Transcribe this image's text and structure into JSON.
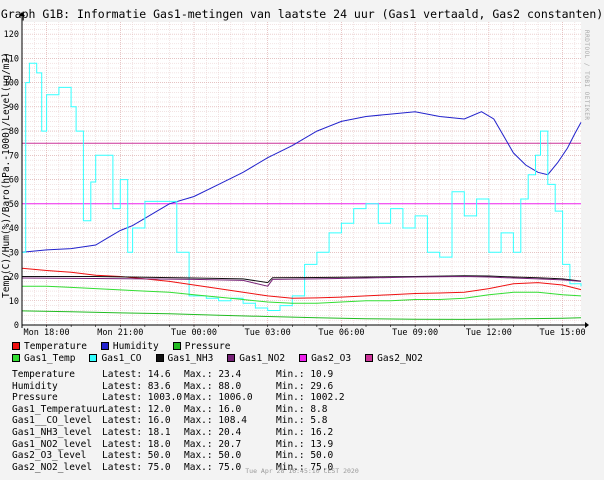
{
  "title": "Graph G1B: Informatie Gas1-metingen van laatste 24 uur (Gas1 vertaald, Gas2 constanten)",
  "side_text": "RRDTOOL / TOBI OETIKER",
  "footer": "Tue Apr 28 16:45:10 CEST 2020",
  "legend": [
    {
      "label": "Temperature",
      "color": "#ee1111"
    },
    {
      "label": "Humidity",
      "color": "#2222cc"
    },
    {
      "label": "Pressure",
      "color": "#22bb22"
    },
    {
      "label": "Gas1_Temp",
      "color": "#33dd33"
    },
    {
      "label": "Gas1_CO",
      "color": "#33ffff"
    },
    {
      "label": "Gas1_NH3",
      "color": "#111111"
    },
    {
      "label": "Gas1_NO2",
      "color": "#772277"
    },
    {
      "label": "Gas2_O3",
      "color": "#ee22ee"
    },
    {
      "label": "Gas2_NO2",
      "color": "#cc3399"
    }
  ],
  "stats": [
    {
      "name": "Temperature",
      "latest": "Latest: 14.6",
      "max": "Max.: 23.4",
      "min": "Min.: 10.9"
    },
    {
      "name": "Humidity",
      "latest": "Latest: 83.6",
      "max": "Max.: 88.0",
      "min": "Min.: 29.6"
    },
    {
      "name": "Pressure",
      "latest": "Latest: 1003.0",
      "max": "Max.: 1006.0",
      "min": "Min.: 1002.2"
    },
    {
      "name": "Gas1_Temperatuur",
      "latest": "Latest: 12.0",
      "max": "Max.: 16.0",
      "min": "Min.: 8.8"
    },
    {
      "name": "Gas1__CO_level",
      "latest": "Latest: 16.0",
      "max": "Max.: 108.4",
      "min": "Min.: 5.8"
    },
    {
      "name": "Gas1_NH3_level",
      "latest": "Latest: 18.1",
      "max": "Max.: 20.4",
      "min": "Min.: 16.2"
    },
    {
      "name": "Gas1_NO2_level",
      "latest": "Latest: 18.0",
      "max": "Max.: 20.7",
      "min": "Min.: 13.9"
    },
    {
      "name": "Gas2_O3_level",
      "latest": "Latest: 50.0",
      "max": "Max.: 50.0",
      "min": "Min.: 50.0"
    },
    {
      "name": "Gas2_NO2_level",
      "latest": "Latest: 75.0",
      "max": "Max.: 75.0",
      "min": "Min.: 75.0"
    }
  ],
  "chart_data": {
    "type": "line",
    "title": "Graph G1B: Informatie Gas1-metingen van laatste 24 uur (Gas1 vertaald, Gas2 constanten)",
    "ylabel": "Temp(C)/Hum(%)/Baro(hPa.-1000)/Level(ug/m3)",
    "xlabel": "",
    "ylim": [
      0,
      125
    ],
    "xlim": [
      0,
      22.75
    ],
    "yticks": [
      0,
      10,
      20,
      30,
      40,
      50,
      60,
      70,
      80,
      90,
      100,
      110,
      120
    ],
    "x_ticks": [
      {
        "label": "Mon 18:00",
        "x": 1
      },
      {
        "label": "Mon 21:00",
        "x": 4
      },
      {
        "label": "Tue 00:00",
        "x": 7
      },
      {
        "label": "Tue 03:00",
        "x": 10
      },
      {
        "label": "Tue 06:00",
        "x": 13
      },
      {
        "label": "Tue 09:00",
        "x": 16
      },
      {
        "label": "Tue 12:00",
        "x": 19
      },
      {
        "label": "Tue 15:00",
        "x": 22
      }
    ],
    "grid": true,
    "legend_position": "bottom",
    "series": [
      {
        "name": "Gas2_O3",
        "color": "#ee22ee",
        "points": [
          [
            0,
            50
          ],
          [
            22.75,
            50
          ]
        ]
      },
      {
        "name": "Gas2_NO2",
        "color": "#cc3399",
        "points": [
          [
            0,
            75
          ],
          [
            22.75,
            75
          ]
        ]
      },
      {
        "name": "Humidity",
        "color": "#2222cc",
        "points": [
          [
            0,
            30
          ],
          [
            1,
            31
          ],
          [
            2,
            31.5
          ],
          [
            3,
            33
          ],
          [
            3.5,
            36
          ],
          [
            4,
            39
          ],
          [
            4.5,
            41
          ],
          [
            5,
            44
          ],
          [
            5.5,
            47
          ],
          [
            6,
            50
          ],
          [
            7,
            53
          ],
          [
            8,
            58
          ],
          [
            9,
            63
          ],
          [
            10,
            69
          ],
          [
            11,
            74
          ],
          [
            12,
            80
          ],
          [
            13,
            84
          ],
          [
            14,
            86
          ],
          [
            15,
            87
          ],
          [
            16,
            88
          ],
          [
            17,
            86
          ],
          [
            18,
            85
          ],
          [
            18.7,
            88
          ],
          [
            19.2,
            85
          ],
          [
            19.6,
            78
          ],
          [
            20,
            71
          ],
          [
            20.5,
            66
          ],
          [
            21,
            63
          ],
          [
            21.4,
            62
          ],
          [
            21.8,
            67
          ],
          [
            22.2,
            73
          ],
          [
            22.5,
            79
          ],
          [
            22.75,
            83.6
          ]
        ]
      },
      {
        "name": "Gas1_CO",
        "color": "#33ffff",
        "points": [
          [
            0,
            30
          ],
          [
            0.15,
            100
          ],
          [
            0.3,
            108
          ],
          [
            0.6,
            104
          ],
          [
            0.8,
            80
          ],
          [
            1.0,
            95
          ],
          [
            1.5,
            98
          ],
          [
            2.0,
            90
          ],
          [
            2.2,
            80
          ],
          [
            2.5,
            43
          ],
          [
            2.8,
            59
          ],
          [
            3.0,
            70
          ],
          [
            3.4,
            70
          ],
          [
            3.7,
            48
          ],
          [
            4.0,
            60
          ],
          [
            4.3,
            30
          ],
          [
            4.5,
            40
          ],
          [
            5.0,
            51
          ],
          [
            5.5,
            51
          ],
          [
            6.0,
            51
          ],
          [
            6.3,
            30
          ],
          [
            6.8,
            12
          ],
          [
            7.5,
            11
          ],
          [
            8.0,
            10
          ],
          [
            8.5,
            11
          ],
          [
            9.0,
            9
          ],
          [
            9.5,
            7
          ],
          [
            10.0,
            6
          ],
          [
            10.5,
            8
          ],
          [
            11.0,
            12
          ],
          [
            11.5,
            25
          ],
          [
            12.0,
            30
          ],
          [
            12.5,
            38
          ],
          [
            13.0,
            42
          ],
          [
            13.5,
            48
          ],
          [
            14.0,
            50
          ],
          [
            14.5,
            42
          ],
          [
            15.0,
            48
          ],
          [
            15.5,
            40
          ],
          [
            16.0,
            45
          ],
          [
            16.5,
            30
          ],
          [
            17.0,
            28
          ],
          [
            17.5,
            55
          ],
          [
            18.0,
            45
          ],
          [
            18.5,
            52
          ],
          [
            19.0,
            30
          ],
          [
            19.5,
            38
          ],
          [
            20.0,
            30
          ],
          [
            20.3,
            52
          ],
          [
            20.6,
            62
          ],
          [
            20.9,
            70
          ],
          [
            21.1,
            80
          ],
          [
            21.4,
            58
          ],
          [
            21.7,
            47
          ],
          [
            22.0,
            25
          ],
          [
            22.3,
            17
          ],
          [
            22.75,
            16
          ]
        ]
      },
      {
        "name": "Temperature",
        "color": "#ee1111",
        "points": [
          [
            0,
            23.4
          ],
          [
            1,
            22.5
          ],
          [
            2,
            21.8
          ],
          [
            3,
            20.5
          ],
          [
            4,
            20
          ],
          [
            5,
            19
          ],
          [
            6,
            18
          ],
          [
            7,
            16.5
          ],
          [
            8,
            15
          ],
          [
            9,
            13.5
          ],
          [
            10,
            12
          ],
          [
            11,
            11
          ],
          [
            12,
            11.2
          ],
          [
            13,
            11.5
          ],
          [
            14,
            12
          ],
          [
            15,
            12.5
          ],
          [
            16,
            13
          ],
          [
            17,
            13.2
          ],
          [
            18,
            13.5
          ],
          [
            19,
            15
          ],
          [
            20,
            17
          ],
          [
            21,
            17.5
          ],
          [
            22,
            16.5
          ],
          [
            22.75,
            14.6
          ]
        ]
      },
      {
        "name": "Gas1_NH3",
        "color": "#111111",
        "points": [
          [
            0,
            20
          ],
          [
            3,
            20
          ],
          [
            5,
            19.7
          ],
          [
            7,
            19.4
          ],
          [
            9,
            19
          ],
          [
            10,
            17.5
          ],
          [
            10.2,
            19.5
          ],
          [
            12,
            19.6
          ],
          [
            14,
            19.8
          ],
          [
            16,
            20
          ],
          [
            18,
            20.3
          ],
          [
            19,
            20.2
          ],
          [
            20,
            19.8
          ],
          [
            21,
            19.5
          ],
          [
            22,
            19
          ],
          [
            22.75,
            18.1
          ]
        ]
      },
      {
        "name": "Gas1_NO2",
        "color": "#772277",
        "points": [
          [
            0,
            19.4
          ],
          [
            3,
            19.2
          ],
          [
            5,
            19
          ],
          [
            7,
            18.8
          ],
          [
            9,
            18.4
          ],
          [
            10,
            16
          ],
          [
            10.2,
            18.8
          ],
          [
            12,
            19
          ],
          [
            14,
            19.4
          ],
          [
            16,
            19.8
          ],
          [
            18,
            20
          ],
          [
            19,
            19.8
          ],
          [
            20,
            19.4
          ],
          [
            21,
            19
          ],
          [
            22,
            18.6
          ],
          [
            22.75,
            18
          ]
        ]
      },
      {
        "name": "Gas1_Temp",
        "color": "#33dd33",
        "points": [
          [
            0,
            16
          ],
          [
            1,
            16
          ],
          [
            2,
            15.5
          ],
          [
            3,
            15
          ],
          [
            4,
            14.5
          ],
          [
            5,
            14
          ],
          [
            6,
            13.5
          ],
          [
            7,
            12.5
          ],
          [
            8,
            11.5
          ],
          [
            9,
            10.5
          ],
          [
            10,
            9.5
          ],
          [
            11,
            9
          ],
          [
            12,
            9
          ],
          [
            13,
            9.5
          ],
          [
            14,
            10
          ],
          [
            15,
            10
          ],
          [
            16,
            10.5
          ],
          [
            17,
            10.5
          ],
          [
            18,
            11
          ],
          [
            19,
            12.5
          ],
          [
            20,
            13.5
          ],
          [
            21,
            13.5
          ],
          [
            22,
            12.5
          ],
          [
            22.75,
            12
          ]
        ]
      },
      {
        "name": "Pressure",
        "color": "#22bb22",
        "points": [
          [
            0,
            5.8
          ],
          [
            2,
            5.5
          ],
          [
            4,
            5
          ],
          [
            6,
            4.6
          ],
          [
            8,
            4
          ],
          [
            10,
            3.5
          ],
          [
            12,
            3
          ],
          [
            14,
            2.6
          ],
          [
            16,
            2.4
          ],
          [
            18,
            2.3
          ],
          [
            20,
            2.5
          ],
          [
            22,
            2.8
          ],
          [
            22.75,
            3
          ]
        ]
      }
    ]
  }
}
